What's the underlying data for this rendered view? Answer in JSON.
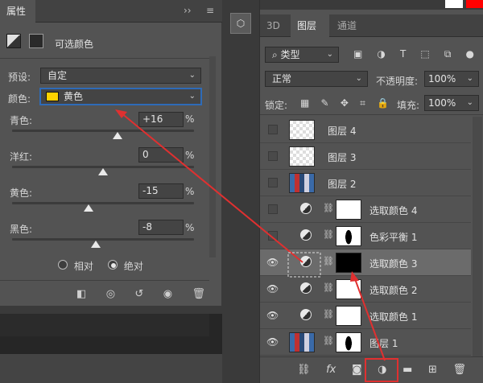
{
  "props": {
    "tab": "属性",
    "tab_controls": "››",
    "menu": "≡",
    "title": "可选颜色",
    "preset_label": "预设:",
    "preset_value": "自定",
    "color_label": "颜色:",
    "color_value": "黄色",
    "color_swatch": "#ffd200",
    "sliders": [
      {
        "label": "青色:",
        "value": "+16",
        "unit": "%",
        "level": 0.58
      },
      {
        "label": "洋红:",
        "value": "0",
        "unit": "%",
        "level": 0.5
      },
      {
        "label": "黄色:",
        "value": "-15",
        "unit": "%",
        "level": 0.42
      },
      {
        "label": "黑色:",
        "value": "-8",
        "unit": "%",
        "level": 0.46
      }
    ],
    "method_relative": "相对",
    "method_absolute": "绝对"
  },
  "layers": {
    "tab_3d": "3D",
    "tab_layers": "图层",
    "tab_channels": "通道",
    "filter_type": "类型",
    "blend_mode": "正常",
    "opacity_label": "不透明度:",
    "opacity_value": "100%",
    "lock_label": "锁定:",
    "fill_label": "填充:",
    "fill_value": "100%",
    "rows": [
      {
        "name": "图层 4",
        "kind": "pixel",
        "visible": false
      },
      {
        "name": "图层 3",
        "kind": "pixel",
        "visible": false
      },
      {
        "name": "图层 2",
        "kind": "photo",
        "visible": false
      },
      {
        "name": "选取颜色 4",
        "kind": "adjust",
        "mask": "white",
        "visible": false
      },
      {
        "name": "色彩平衡 1",
        "kind": "adjust",
        "mask": "figure",
        "visible": false
      },
      {
        "name": "选取颜色 3",
        "kind": "adjust",
        "mask": "black",
        "visible": true,
        "selected": true
      },
      {
        "name": "选取颜色 2",
        "kind": "adjust",
        "mask": "white",
        "visible": true
      },
      {
        "name": "选取颜色 1",
        "kind": "adjust",
        "mask": "white",
        "visible": true
      },
      {
        "name": "图层 1",
        "kind": "photo",
        "mask": "figure",
        "visible": true
      }
    ],
    "bottom_fx": "fx"
  },
  "colors": {
    "annotation": "#e03030",
    "accent_red": "#ff0000"
  }
}
